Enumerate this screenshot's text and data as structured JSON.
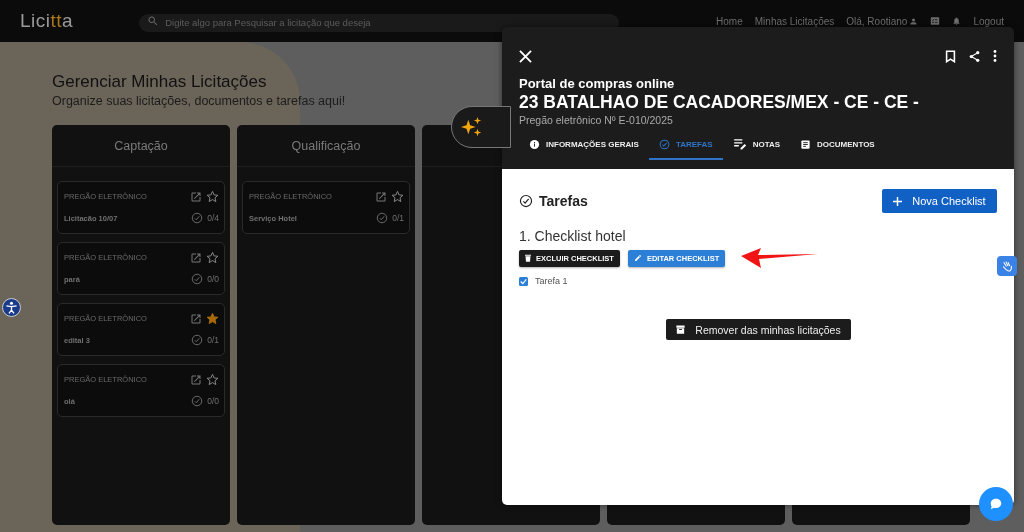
{
  "topbar": {
    "logo": [
      {
        "text": "Lici",
        "accent": false
      },
      {
        "text": "tt",
        "accent": true
      },
      {
        "text": "a",
        "accent": false
      }
    ],
    "search": {
      "placeholder": "Digite algo para Pesquisar a licitação que deseja"
    },
    "nav": [
      "Home",
      "Minhas Licitações",
      "Olá, Rootiano",
      "Logout"
    ]
  },
  "page": {
    "title": "Gerenciar Minhas Licitações",
    "subtitle": "Organize suas licitações, documentos e tarefas aqui!"
  },
  "columns": [
    {
      "title": "Captação",
      "cards": [
        {
          "type": "PREGÃO ELETRÔNICO",
          "name": "Licitacão 10/07",
          "tasks": "0/4",
          "starred": false
        },
        {
          "type": "PREGÃO ELETRÔNICO",
          "name": "pará",
          "tasks": "0/0",
          "starred": false
        },
        {
          "type": "PREGÃO ELETRÔNICO",
          "name": "edital 3",
          "tasks": "0/1",
          "starred": true
        },
        {
          "type": "PREGÃO ELETRÔNICO",
          "name": "olá",
          "tasks": "0/0",
          "starred": false
        }
      ]
    },
    {
      "title": "Qualificação",
      "cards": [
        {
          "type": "PREGÃO ELETRÔNICO",
          "name": "Serviço Hotel",
          "tasks": "0/1",
          "starred": false
        }
      ]
    }
  ],
  "drawer": {
    "source": "Portal de compras online",
    "title": "23 BATALHAO DE CACADORES/MEX - CE - CE -",
    "subtitle": "Pregão eletrônico Nº E-010/2025",
    "tabs": [
      {
        "label": "INFORMAÇÕES GERAIS",
        "selected": false
      },
      {
        "label": "TAREFAS",
        "selected": true
      },
      {
        "label": "NOTAS",
        "selected": false
      },
      {
        "label": "DOCUMENTOS",
        "selected": false
      }
    ],
    "heading": "Tarefas",
    "new_button": "Nova Checklist",
    "checklists": [
      {
        "title": "1. Checklist hotel",
        "delete_button": "EXCLUIR CHECKLIST",
        "edit_button": "EDITAR CHECKLIST",
        "items": [
          {
            "label": "Tarefa 1",
            "checked": true
          }
        ]
      }
    ],
    "remove_button": "Remover das minhas licitações"
  }
}
